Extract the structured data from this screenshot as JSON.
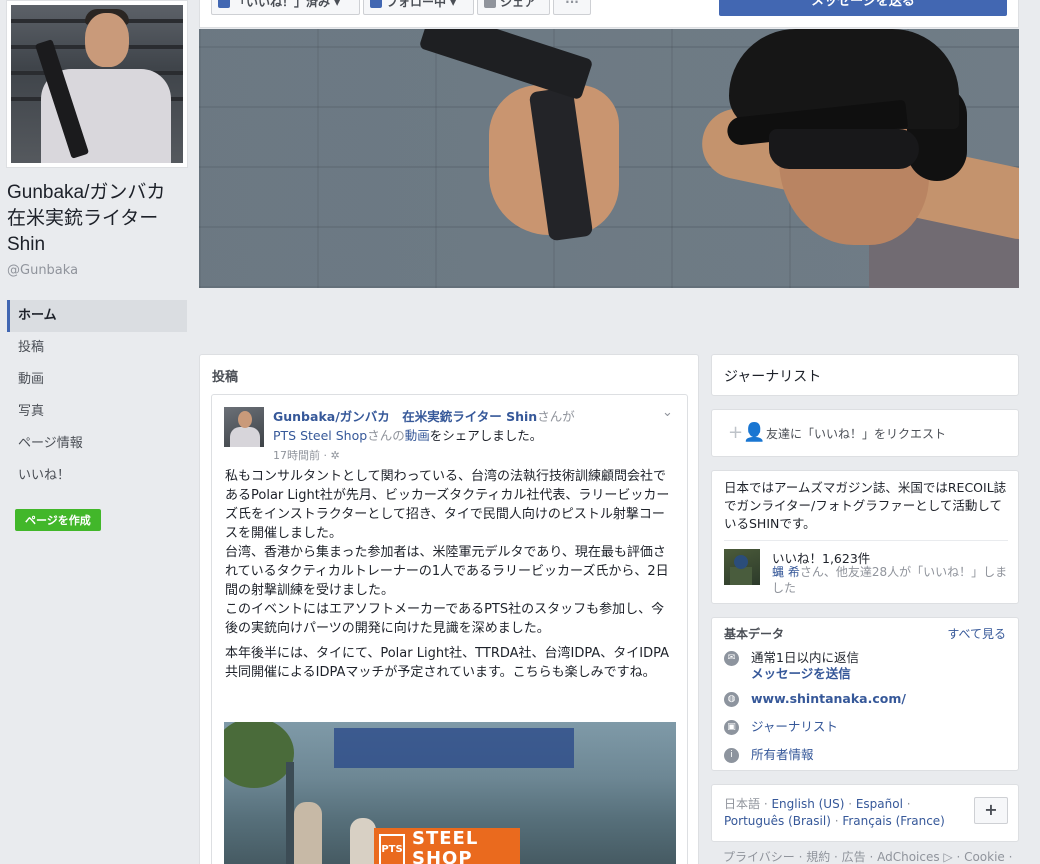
{
  "page": {
    "name": "Gunbaka/ガンバカ　在米実銃ライター Shin",
    "handle": "@Gunbaka"
  },
  "left_nav": {
    "items": [
      {
        "label": "ホーム"
      },
      {
        "label": "投稿"
      },
      {
        "label": "動画"
      },
      {
        "label": "写真"
      },
      {
        "label": "ページ情報"
      },
      {
        "label": "いいね！"
      }
    ],
    "create_page_label": "ページを作成"
  },
  "action_bar": {
    "like_label": "「いいね！」済み ▾",
    "follow_label": "フォロー中 ▾",
    "share_label": "シェア",
    "more_label": "···",
    "message_label": "メッセージを送る"
  },
  "posts": {
    "section_title": "投稿",
    "post": {
      "author": "Gunbaka/ガンバカ　在米実銃ライター Shin",
      "author_suffix": "さんが",
      "shared_page": "PTS Steel Shop",
      "shared_mid": "さんの",
      "shared_object": "動画",
      "shared_end": "をシェアしました。",
      "time": "17時間前 · ✲",
      "paragraphs": [
        "私もコンサルタントとして関わっている、台湾の法執行技術訓練顧問会社であるPolar Light社が先月、ビッカーズタクティカル社代表、ラリービッカーズ氏をインストラクターとして招き、タイで民間人向けのピストル射撃コースを開催しました。\n台湾、香港から集まった参加者は、米陸軍元デルタであり、現在最も評価されているタクティカルトレーナーの1人であるラリービッカーズ氏から、2日間の射撃訓練を受けました。\nこのイベントにはエアソフトメーカーであるPTS社のスタッフも参加し、今後の実銃向けパーツの開発に向けた見識を深めました。",
        "本年後半には、タイにて、Polar Light社、TTRDA社、台湾IDPA、タイIDPA共同開催によるIDPAマッチが予定されています。こちらも楽しみですね。"
      ],
      "video_logo": {
        "mark": "PTS",
        "line1": "STEEL",
        "line2": "SHOP"
      }
    }
  },
  "right": {
    "category": "ジャーナリスト",
    "invite_label": "友達に「いいね！」をリクエスト",
    "about": "日本ではアームズマガジン誌、米国ではRECOIL誌でガンライター/フォトグラファーとして活動しているSHINです。",
    "likes_count": "いいね！1,623件",
    "likes_friend_name": "蝿 希",
    "likes_friends_rest": "さん、他友達28人が「いいね！」しました",
    "basic": {
      "title": "基本データ",
      "see_all": "すべて見る",
      "response_line1": "通常1日以内に返信",
      "response_line2": "メッセージを送信",
      "website": "www.shintanaka.com/",
      "category": "ジャーナリスト",
      "owner": "所有者情報"
    },
    "languages": {
      "current": "日本語",
      "sep": " · ",
      "links": [
        "English (US)",
        "Español",
        "Português (Brasil)",
        "Français (France)"
      ],
      "add_label": "+"
    },
    "footer": "プライバシー · 規約 · 広告 · AdChoices ▷ · Cookie ·"
  },
  "icons": {
    "like": "thumbs-up-icon",
    "follow": "rss-icon",
    "share": "share-arrow-icon",
    "invite": "add-friend-icon",
    "messenger": "messenger-icon",
    "globe": "globe-icon",
    "briefcase": "briefcase-icon",
    "info": "info-icon"
  },
  "colors": {
    "brand": "#4267b2",
    "link": "#365899",
    "green": "#42b72a",
    "background": "#e9ebee"
  }
}
